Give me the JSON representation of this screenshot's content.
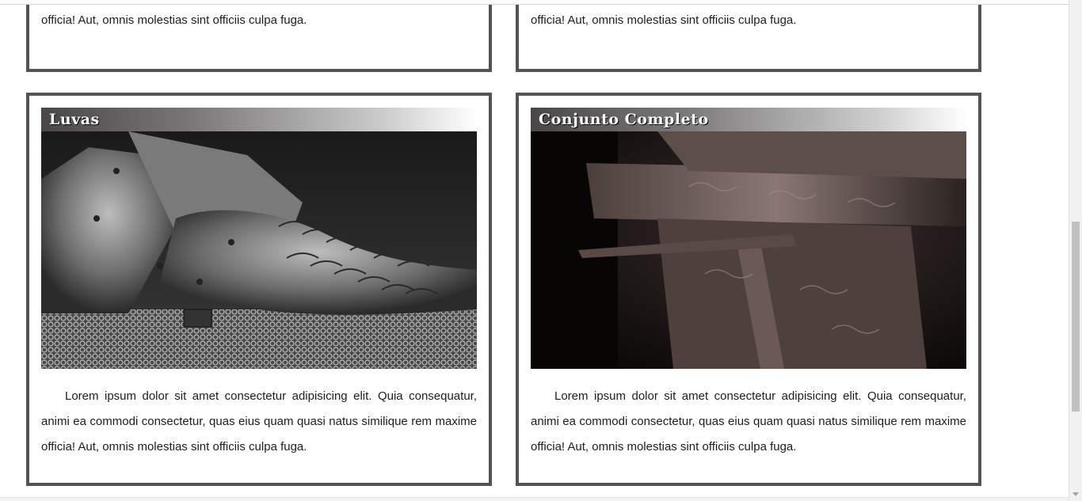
{
  "cards_top": [
    {
      "text": "Lorem ipsum dolor sit amet consectetur adipisicing elit. Quia consequatur, animi ea commodi consectetur, quas eius quam quasi natus similique rem maxime officia! Aut, omnis molestias sint officiis culpa fuga."
    },
    {
      "text": "Lorem ipsum dolor sit amet consectetur adipisicing elit. Quia consequatur, animi ea commodi consectetur, quas eius quam quasi natus similique rem maxime officia! Aut, omnis molestias sint officiis culpa fuga."
    }
  ],
  "cards": [
    {
      "title": "Luvas",
      "image": "armored-gauntlets-on-chainmail",
      "text": "Lorem ipsum dolor sit amet consectetur adipisicing elit. Quia consequatur, animi ea commodi consectetur, quas eius quam quasi natus similique rem maxime officia! Aut, omnis molestias sint officiis culpa fuga."
    },
    {
      "title": "Conjunto Completo",
      "image": "full-ornate-armor-set",
      "text": "Lorem ipsum dolor sit amet consectetur adipisicing elit. Quia consequatur, animi ea commodi consectetur, quas eius quam quasi natus similique rem maxime officia! Aut, omnis molestias sint officiis culpa fuga."
    }
  ],
  "colors": {
    "card_border": "#555356",
    "header_dark": "#4a4748"
  }
}
